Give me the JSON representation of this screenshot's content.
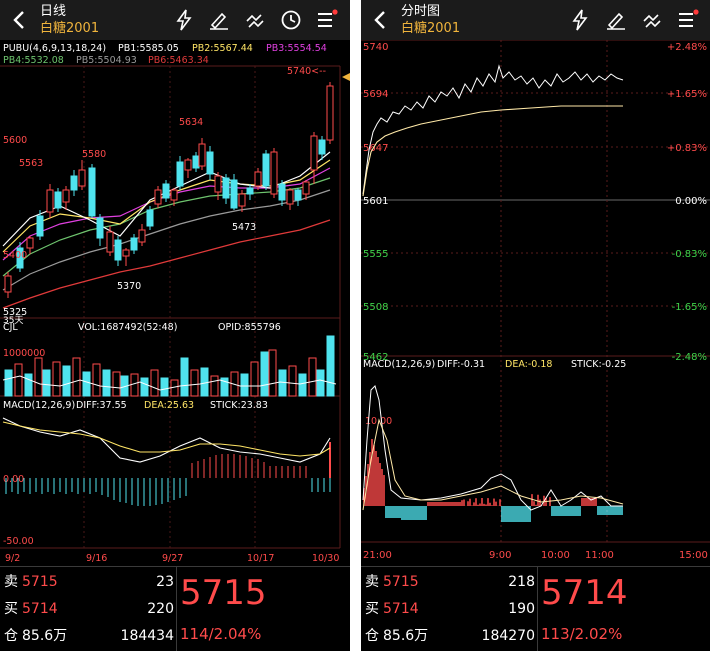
{
  "left": {
    "title": "日线",
    "instrument": "白糖2001",
    "icons": [
      "back-arrow-icon",
      "lightning-icon",
      "draw-pen-icon",
      "wave-icon",
      "clock-icon",
      "menu-icon"
    ],
    "legend": {
      "pubu": "PUBU(4,6,9,13,18,24)",
      "pb1": "PB1:5585.05",
      "pb2": "PB2:5567.44",
      "pb3": "PB3:5554.54",
      "pb4": "PB4:5532.08",
      "pb5": "PB5:5504.93",
      "pb6": "PB6:5463.34"
    },
    "price_labels": {
      "p5740": "5740<--",
      "p5634": "5634",
      "p5600": "5600",
      "p5580": "5580",
      "p5563": "5563",
      "p5473": "5473",
      "p5400": "5400",
      "p5370": "5370",
      "p5325": "5325",
      "p35": "35天"
    },
    "vol_legend": {
      "cjl": "CJL",
      "vol": "VOL:1687492(52:48)",
      "opid": "OPID:855796",
      "scale": "1000000"
    },
    "macd_legend": {
      "macd": "MACD(12,26,9)",
      "diff": "DIFF:37.55",
      "dea": "DEA:25.63",
      "stick": "STICK:23.83",
      "zero": "0.00",
      "neg": "-50.00"
    },
    "dates": [
      "9/2",
      "9/16",
      "9/27",
      "10/17",
      "10/30"
    ],
    "quote": {
      "sell_label": "卖",
      "sell_price": "5715",
      "sell_vol": "23",
      "buy_label": "买",
      "buy_price": "5714",
      "buy_vol": "220",
      "pos_label": "仓",
      "pos_value": "85.6万",
      "pos_vol": "184434",
      "last": "5715",
      "change": "114/2.04%"
    }
  },
  "right": {
    "title": "分时图",
    "instrument": "白糖2001",
    "icons": [
      "back-arrow-icon",
      "lightning-icon",
      "draw-pen-icon",
      "wave-icon",
      "menu-icon"
    ],
    "price_axis": [
      {
        "price": "5740",
        "pct": "+2.48%",
        "color": "#ff4b4b"
      },
      {
        "price": "5694",
        "pct": "+1.65%",
        "color": "#ff4b4b"
      },
      {
        "price": "5647",
        "pct": "+0.83%",
        "color": "#ff4b4b"
      },
      {
        "price": "5601",
        "pct": "0.00%",
        "color": "#ffffff"
      },
      {
        "price": "5555",
        "pct": "-0.83%",
        "color": "#3fd24a"
      },
      {
        "price": "5508",
        "pct": "-1.65%",
        "color": "#3fd24a"
      },
      {
        "price": "5462",
        "pct": "-2.48%",
        "color": "#3fd24a"
      }
    ],
    "macd_legend": {
      "macd": "MACD(12,26,9)",
      "diff": "DIFF:-0.31",
      "dea": "DEA:-0.18",
      "stick": "STICK:-0.25",
      "level": "10.00"
    },
    "times": [
      "21:00",
      "9:00",
      "10:00",
      "11:00",
      "15:00"
    ],
    "quote": {
      "sell_label": "卖",
      "sell_price": "5715",
      "sell_vol": "218",
      "buy_label": "买",
      "buy_price": "5714",
      "buy_vol": "190",
      "pos_label": "仓",
      "pos_value": "85.6万",
      "pos_vol": "184270",
      "last": "5714",
      "change": "113/2.02%"
    }
  },
  "colors": {
    "up": "#ff4b4b",
    "down": "#4fe3ee",
    "gold": "#f0b43c",
    "ma_white": "#ffffff",
    "ma_yellow": "#ffe566",
    "ma_magenta": "#e040e0",
    "ma_green": "#6ec46e",
    "ma_gray": "#9a9a9a",
    "ma_red": "#e03a3a"
  }
}
